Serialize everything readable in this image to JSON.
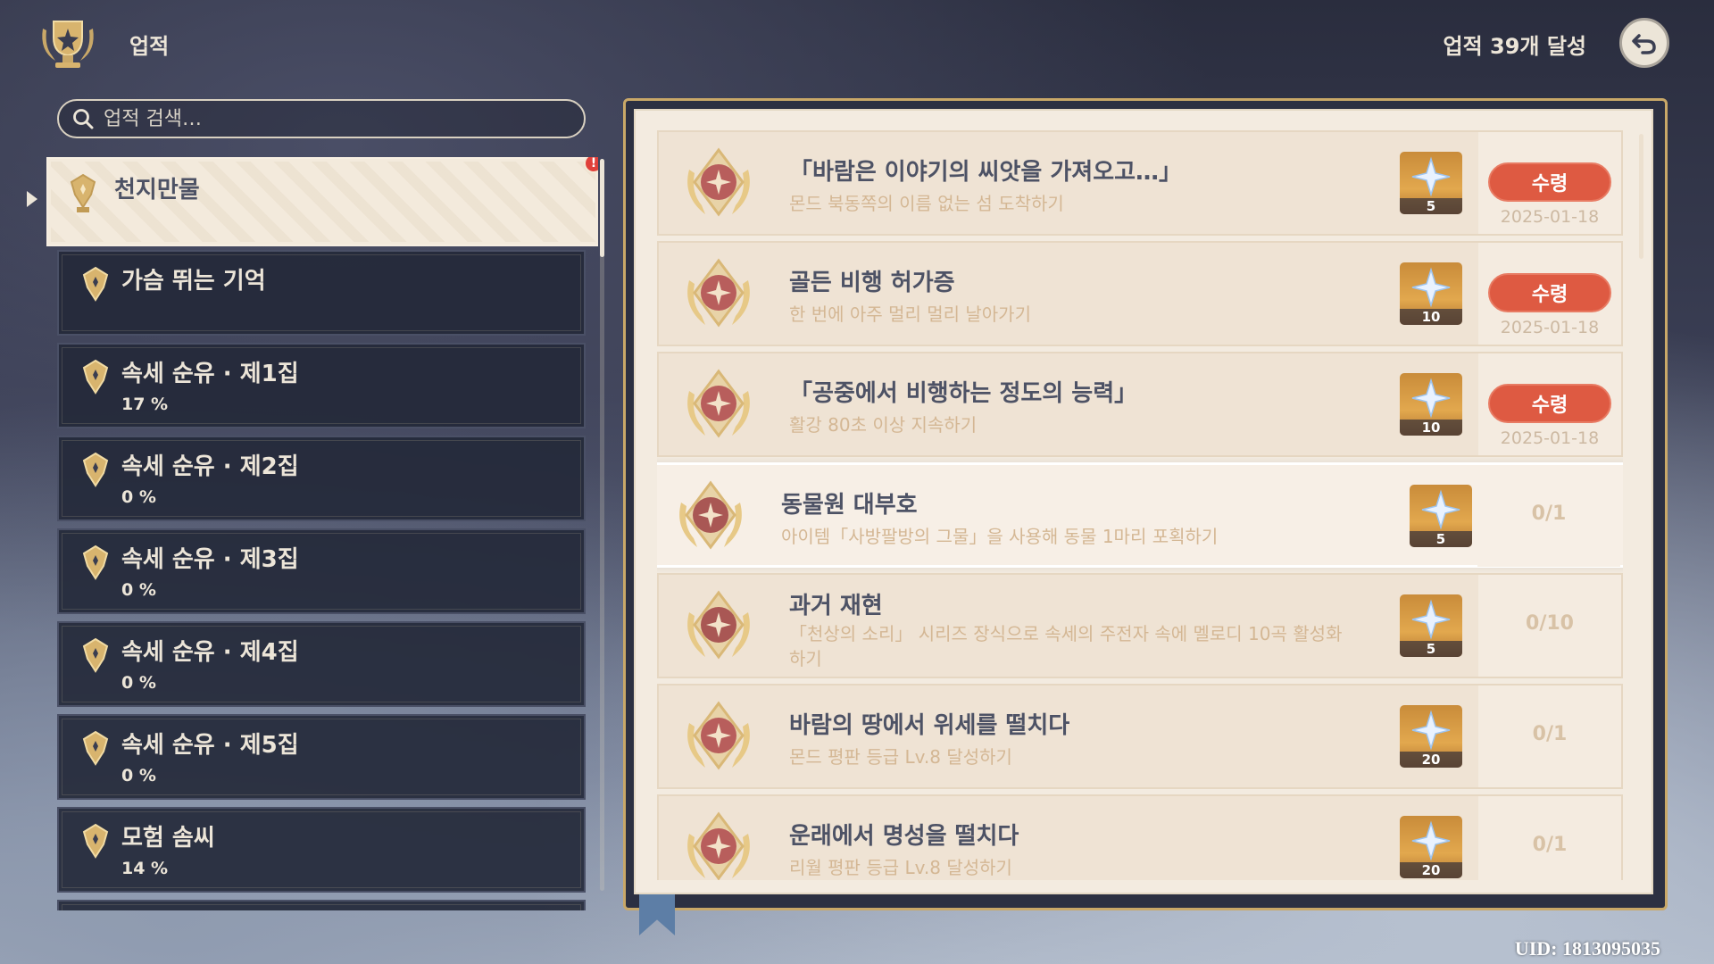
{
  "header": {
    "title": "업적",
    "achievement_count": "업적 39개 달성"
  },
  "search": {
    "placeholder": "업적 검색…"
  },
  "sidebar": {
    "items": [
      {
        "name": "천지만물",
        "percent": "",
        "active": true,
        "alert": "!"
      },
      {
        "name": "가슴 뛰는 기억",
        "percent": ""
      },
      {
        "name": "속세 순유 · 제1집",
        "percent": "17 %"
      },
      {
        "name": "속세 순유 · 제2집",
        "percent": "0 %"
      },
      {
        "name": "속세 순유 · 제3집",
        "percent": "0 %"
      },
      {
        "name": "속세 순유 · 제4집",
        "percent": "0 %"
      },
      {
        "name": "속세 순유 · 제5집",
        "percent": "0 %"
      },
      {
        "name": "모험 솜씨",
        "percent": "14 %"
      }
    ]
  },
  "achievements": [
    {
      "title": "「바람은 이야기의 씨앗을 가져오고…」",
      "desc": "몬드 북동쪽의 이름 없는 섬 도착하기",
      "reward": "5",
      "claim": "수령",
      "date": "2025-01-18"
    },
    {
      "title": "골든 비행 허가증",
      "desc": "한 번에 아주 멀리 멀리 날아가기",
      "reward": "10",
      "claim": "수령",
      "date": "2025-01-18"
    },
    {
      "title": "「공중에서 비행하는 정도의 능력」",
      "desc": "활강 80초 이상 지속하기",
      "reward": "10",
      "claim": "수령",
      "date": "2025-01-18"
    },
    {
      "title": "동물원 대부호",
      "desc": "아이템「사방팔방의 그물」을 사용해 동물 1마리 포획하기",
      "reward": "5",
      "progress": "0/1"
    },
    {
      "title": "과거 재현",
      "desc": "「천상의 소리」 시리즈 장식으로 속세의 주전자 속에 멜로디 10곡 활성화하기",
      "reward": "5",
      "progress": "0/10"
    },
    {
      "title": "바람의 땅에서 위세를 떨치다",
      "desc": "몬드 평판 등급 Lv.8 달성하기",
      "reward": "20",
      "progress": "0/1"
    },
    {
      "title": "운래에서 명성을 떨치다",
      "desc": "리월 평판 등급 Lv.8 달성하기",
      "reward": "20",
      "progress": "0/1"
    }
  ],
  "uid": "UID: 1813095035",
  "colors": {
    "claim_button": "#de5a42",
    "title_text": "#4d5265",
    "desc_text": "#d4b794",
    "reward_bg": "#e2a84e"
  }
}
